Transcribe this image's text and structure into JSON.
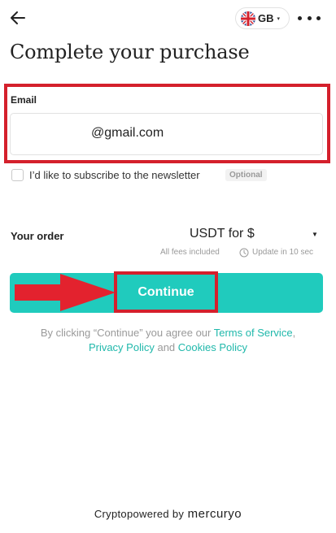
{
  "header": {
    "language": {
      "code": "GB",
      "caret": "▾"
    }
  },
  "title": "Complete your purchase",
  "email": {
    "label": "Email",
    "value": "@gmail.com"
  },
  "newsletter": {
    "label": "I’d like to subscribe to the newsletter",
    "badge": "Optional",
    "checked": false
  },
  "order": {
    "label": "Your order",
    "selected_value": "USDT for $",
    "fees_note": "All fees included",
    "update_note": "Update in 10 sec"
  },
  "continue_button": {
    "label": "Continue"
  },
  "consent": {
    "prefix": "By clicking “Continue” you agree our ",
    "terms_link": "Terms of Service",
    "comma": ",",
    "privacy_link": "Privacy Policy",
    "and": " and ",
    "cookies_link": "Cookies Policy"
  },
  "footer": {
    "powered_text": "Cryptopowered by",
    "brand": "mercuryo"
  },
  "colors": {
    "accent": "#20cbbd",
    "link": "#20b8ab",
    "annotation_red": "#d4202c"
  }
}
